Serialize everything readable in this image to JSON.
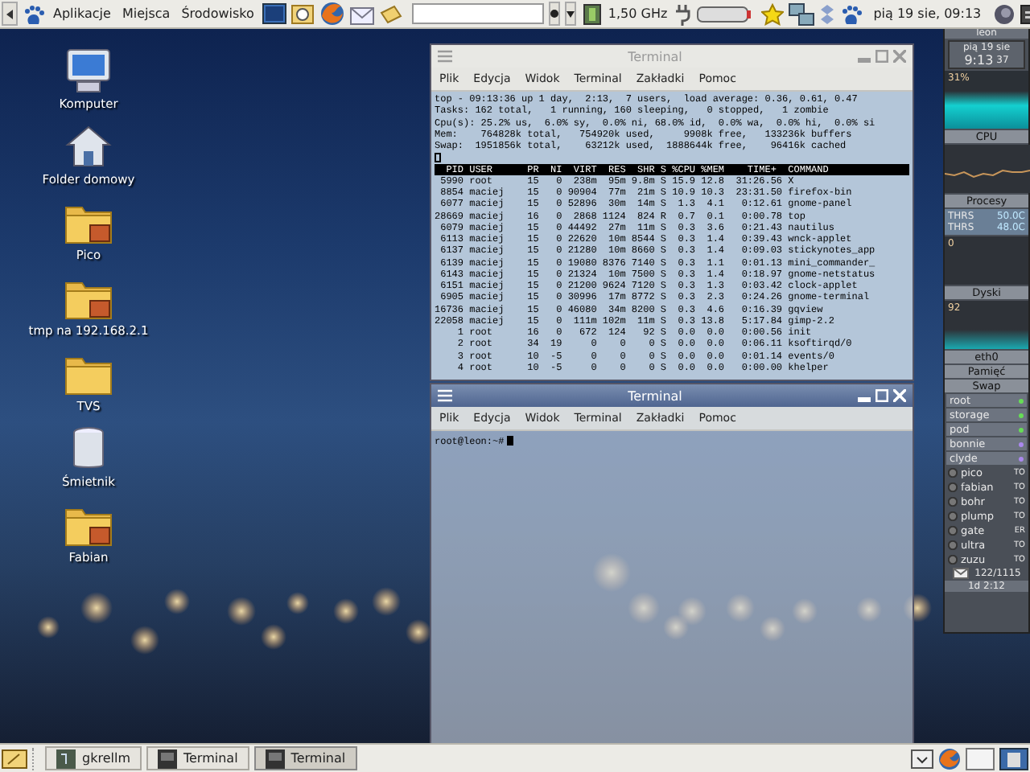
{
  "top_panel": {
    "menus": [
      "Aplikacje",
      "Miejsca",
      "Środowisko"
    ],
    "cpu_freq": "1,50 GHz",
    "clock": "pią 19 sie, 09:13"
  },
  "desktop_icons": [
    {
      "label": "Komputer",
      "kind": "computer"
    },
    {
      "label": "Folder domowy",
      "kind": "home"
    },
    {
      "label": "Pico",
      "kind": "shared"
    },
    {
      "label": "tmp na 192.168.2.1",
      "kind": "shared"
    },
    {
      "label": "TVS",
      "kind": "folder"
    },
    {
      "label": "Śmietnik",
      "kind": "trash"
    },
    {
      "label": "Fabian",
      "kind": "shared"
    }
  ],
  "terminal_top": {
    "title": "Terminal",
    "menu": [
      "Plik",
      "Edycja",
      "Widok",
      "Terminal",
      "Zakładki",
      "Pomoc"
    ],
    "summary": [
      "top - 09:13:36 up 1 day,  2:13,  7 users,  load average: 0.36, 0.61, 0.47",
      "Tasks: 162 total,   1 running, 160 sleeping,   0 stopped,   1 zombie",
      "Cpu(s): 25.2% us,  6.0% sy,  0.0% ni, 68.0% id,  0.0% wa,  0.0% hi,  0.0% si",
      "Mem:    764828k total,   754920k used,     9908k free,   133236k buffers",
      "Swap:  1951856k total,    63212k used,  1888644k free,    96416k cached"
    ],
    "header": "  PID USER      PR  NI  VIRT  RES  SHR S %CPU %MEM    TIME+  COMMAND",
    "rows": [
      " 5990 root      15   0  238m  95m 9.8m S 15.9 12.8  31:26.56 X",
      " 8854 maciej    15   0 90904  77m  21m S 10.9 10.3  23:31.50 firefox-bin",
      " 6077 maciej    15   0 52896  30m  14m S  1.3  4.1   0:12.61 gnome-panel",
      "28669 maciej    16   0  2868 1124  824 R  0.7  0.1   0:00.78 top",
      " 6079 maciej    15   0 44492  27m  11m S  0.3  3.6   0:21.43 nautilus",
      " 6113 maciej    15   0 22620  10m 8544 S  0.3  1.4   0:39.43 wnck-applet",
      " 6137 maciej    15   0 21280  10m 8660 S  0.3  1.4   0:09.03 stickynotes_app",
      " 6139 maciej    15   0 19080 8376 7140 S  0.3  1.1   0:01.13 mini_commander_",
      " 6143 maciej    15   0 21324  10m 7500 S  0.3  1.4   0:18.97 gnome-netstatus",
      " 6151 maciej    15   0 21200 9624 7120 S  0.3  1.3   0:03.42 clock-applet",
      " 6905 maciej    15   0 30996  17m 8772 S  0.3  2.3   0:24.26 gnome-terminal",
      "16736 maciej    15   0 46080  34m 8200 S  0.3  4.6   0:16.39 gqview",
      "22058 maciej    15   0  111m 102m  11m S  0.3 13.8   5:17.84 gimp-2.2",
      "    1 root      16   0   672  124   92 S  0.0  0.0   0:00.56 init",
      "    2 root      34  19     0    0    0 S  0.0  0.0   0:06.11 ksoftirqd/0",
      "    3 root      10  -5     0    0    0 S  0.0  0.0   0:01.14 events/0",
      "    4 root      10  -5     0    0    0 S  0.0  0.0   0:00.00 khelper"
    ]
  },
  "terminal_bottom": {
    "title": "Terminal",
    "menu": [
      "Plik",
      "Edycja",
      "Widok",
      "Terminal",
      "Zakładki",
      "Pomoc"
    ],
    "prompt": "root@leon:~#"
  },
  "gkrellm": {
    "host": "leon",
    "date": "pią 19 sie",
    "time": "9:13",
    "seconds": "37",
    "cpu_percent": "31%",
    "cpu_label": "CPU",
    "proc_label": "Procesy",
    "sensors": [
      {
        "name": "THRS",
        "value": "50.0C"
      },
      {
        "name": "THRS",
        "value": "48.0C"
      }
    ],
    "proc_value": "0",
    "disk_label": "Dyski",
    "disk_value": "92",
    "net_label": "eth0",
    "mem_label": "Pamięć",
    "swap_label": "Swap",
    "mounts": [
      {
        "name": "root",
        "color": "#66dd55"
      },
      {
        "name": "storage",
        "color": "#66dd55"
      },
      {
        "name": "pod",
        "color": "#66dd55"
      },
      {
        "name": "bonnie",
        "color": "#aa88ee"
      },
      {
        "name": "clyde",
        "color": "#aa88ee"
      }
    ],
    "hosts": [
      {
        "name": "pico",
        "status": "TO"
      },
      {
        "name": "fabian",
        "status": "TO"
      },
      {
        "name": "bohr",
        "status": "TO"
      },
      {
        "name": "plump",
        "status": "TO"
      },
      {
        "name": "gate",
        "status": "ER"
      },
      {
        "name": "ultra",
        "status": "TO"
      },
      {
        "name": "zuzu",
        "status": "TO"
      }
    ],
    "mail": "122/1115",
    "uptime": "1d 2:12"
  },
  "taskbar": [
    {
      "label": "gkrellm",
      "selected": false
    },
    {
      "label": "Terminal",
      "selected": false
    },
    {
      "label": "Terminal",
      "selected": true
    }
  ]
}
